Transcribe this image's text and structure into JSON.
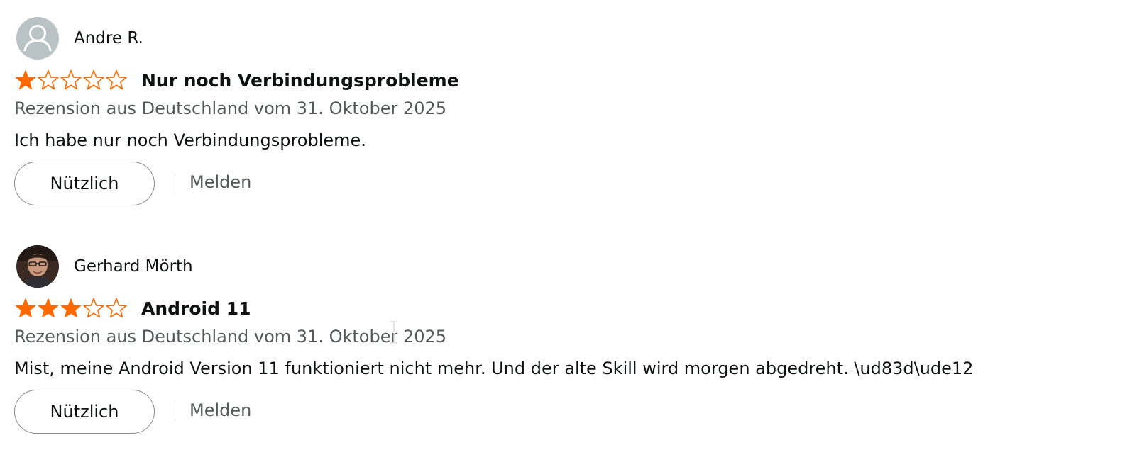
{
  "colors": {
    "star_filled": "#ff6a00",
    "star_outline": "#ff6a00",
    "text_primary": "#0f1111",
    "text_secondary": "#565959",
    "button_border": "#888c8c"
  },
  "reviews": [
    {
      "author": "Andre R.",
      "avatar_icon": "default-user-icon",
      "rating": 1,
      "rating_max": 5,
      "title": "Nur noch Verbindungsprobleme",
      "date_line": "Rezension aus Deutschland vom 31. Oktober 2025",
      "body": "Ich habe nur noch Verbindungsprobleme.",
      "helpful_label": "Nützlich",
      "report_label": "Melden"
    },
    {
      "author": "Gerhard Mörth",
      "avatar_icon": "user-photo",
      "rating": 3,
      "rating_max": 5,
      "title": "Android 11",
      "date_line": "Rezension aus Deutschland vom 31. Oktober 2025",
      "body": "Mist, meine Android Version 11 funktioniert nicht mehr. Und der alte Skill wird morgen abgedreht. \\ud83d\\ude12",
      "helpful_label": "Nützlich",
      "report_label": "Melden"
    }
  ]
}
